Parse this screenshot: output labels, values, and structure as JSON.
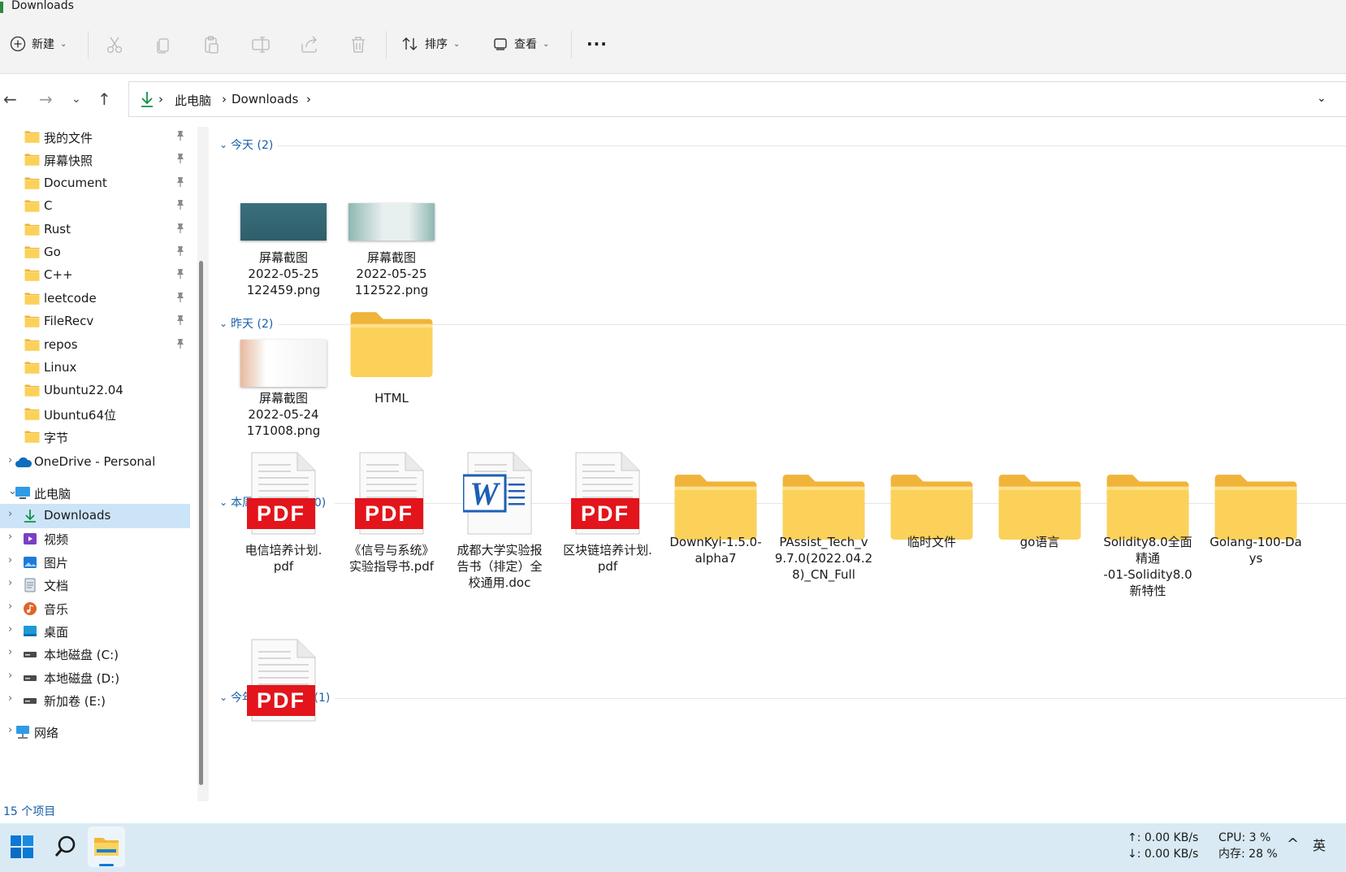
{
  "window": {
    "title": "Downloads"
  },
  "toolbar": {
    "new_label": "新建",
    "sort_label": "排序",
    "view_label": "查看",
    "more_label": "···"
  },
  "address": {
    "segments": [
      "此电脑",
      "Downloads"
    ]
  },
  "sidebar": {
    "quick_access": [
      {
        "label": "我的文件",
        "pinned": true
      },
      {
        "label": "屏幕快照",
        "pinned": true
      },
      {
        "label": "Document",
        "pinned": true
      },
      {
        "label": "C",
        "pinned": true
      },
      {
        "label": "Rust",
        "pinned": true
      },
      {
        "label": "Go",
        "pinned": true
      },
      {
        "label": "C++",
        "pinned": true
      },
      {
        "label": "leetcode",
        "pinned": true
      },
      {
        "label": "FileRecv",
        "pinned": true
      },
      {
        "label": "repos",
        "pinned": true
      },
      {
        "label": "Linux",
        "pinned": false
      },
      {
        "label": "Ubuntu22.04",
        "pinned": false
      },
      {
        "label": "Ubuntu64位",
        "pinned": false
      },
      {
        "label": "字节",
        "pinned": false
      }
    ],
    "onedrive": "OneDrive - Personal",
    "this_pc": "此电脑",
    "pc_items": [
      {
        "label": "Downloads",
        "icon": "download-icon",
        "selected": true
      },
      {
        "label": "视频",
        "icon": "video-icon"
      },
      {
        "label": "图片",
        "icon": "picture-icon"
      },
      {
        "label": "文档",
        "icon": "document-icon"
      },
      {
        "label": "音乐",
        "icon": "music-icon"
      },
      {
        "label": "桌面",
        "icon": "desktop-icon"
      },
      {
        "label": "本地磁盘 (C:)",
        "icon": "drive-icon"
      },
      {
        "label": "本地磁盘 (D:)",
        "icon": "drive-icon"
      },
      {
        "label": "新加卷 (E:)",
        "icon": "drive-icon"
      }
    ],
    "network": "网络"
  },
  "groups": [
    {
      "title": "今天 (2)",
      "items": [
        {
          "lines": [
            "屏幕截图",
            "2022-05-25",
            "122459.png"
          ],
          "type": "image"
        },
        {
          "lines": [
            "屏幕截图",
            "2022-05-25",
            "112522.png"
          ],
          "type": "image"
        }
      ]
    },
    {
      "title": "昨天 (2)",
      "items": [
        {
          "lines": [
            "屏幕截图",
            "2022-05-24",
            "171008.png"
          ],
          "type": "image"
        },
        {
          "lines": [
            "HTML"
          ],
          "type": "folder"
        }
      ]
    },
    {
      "title": "本周早些时候 (10)",
      "items": [
        {
          "lines": [
            "电信培养计划.",
            "pdf"
          ],
          "type": "pdf"
        },
        {
          "lines": [
            "《信号与系统》",
            "实验指导书.pdf"
          ],
          "type": "pdf"
        },
        {
          "lines": [
            "成都大学实验报",
            "告书（排定）全",
            "校通用.doc"
          ],
          "type": "word"
        },
        {
          "lines": [
            "区块链培养计划.",
            "pdf"
          ],
          "type": "pdf"
        },
        {
          "lines": [
            "DownKyi-1.5.0-",
            "alpha7"
          ],
          "type": "folder"
        },
        {
          "lines": [
            "PAssist_Tech_v",
            "9.7.0(2022.04.2",
            "8)_CN_Full"
          ],
          "type": "folder"
        },
        {
          "lines": [
            "临时文件"
          ],
          "type": "folder"
        },
        {
          "lines": [
            "go语言"
          ],
          "type": "folder"
        },
        {
          "lines": [
            "Solidity8.0全面",
            "精通",
            "-01-Solidity8.0",
            "新特性"
          ],
          "type": "folder"
        },
        {
          "lines": [
            "Golang-100-Da",
            "ys"
          ],
          "type": "folder"
        }
      ]
    },
    {
      "title": "今年的早些时候 (1)",
      "items": [
        {
          "lines": [],
          "type": "pdf"
        }
      ]
    }
  ],
  "pdf_badge": "PDF",
  "status": {
    "count": "15 个项目"
  },
  "taskbar": {
    "net_up": "↑: 0.00 KB/s",
    "net_down": "↓: 0.00 KB/s",
    "cpu": "CPU: 3 %",
    "mem": "内存: 28 %",
    "ime": "英"
  },
  "colors": {
    "accent": "#1a5fa6",
    "selection": "#cce4f7",
    "folder": "#f8c94a",
    "pdf_red": "#e3141b",
    "word_blue": "#1e5fb4"
  }
}
